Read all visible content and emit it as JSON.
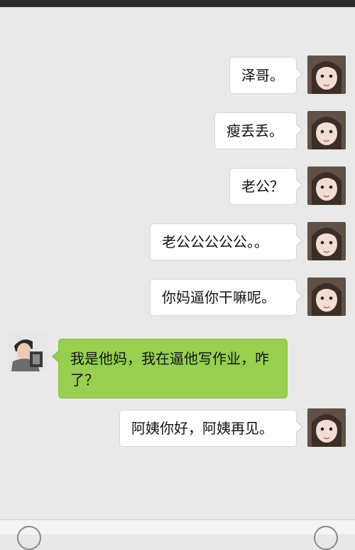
{
  "messages": [
    {
      "side": "right",
      "text": "泽哥。"
    },
    {
      "side": "right",
      "text": "瘦丢丢。"
    },
    {
      "side": "right",
      "text": "老公？"
    },
    {
      "side": "right",
      "text": "老公公公公公。。"
    },
    {
      "side": "right",
      "text": "你妈逼你干嘛呢。"
    },
    {
      "side": "left",
      "text": "我是他妈，我在逼他写作业，咋了？"
    },
    {
      "side": "right",
      "text": "阿姨你好，阿姨再见。"
    }
  ],
  "colors": {
    "background": "#e9e9e9",
    "sent_bubble": "#ffffff",
    "received_bubble": "#97cf4f"
  },
  "icons": {
    "voice": "voice-icon",
    "add": "add-icon"
  }
}
